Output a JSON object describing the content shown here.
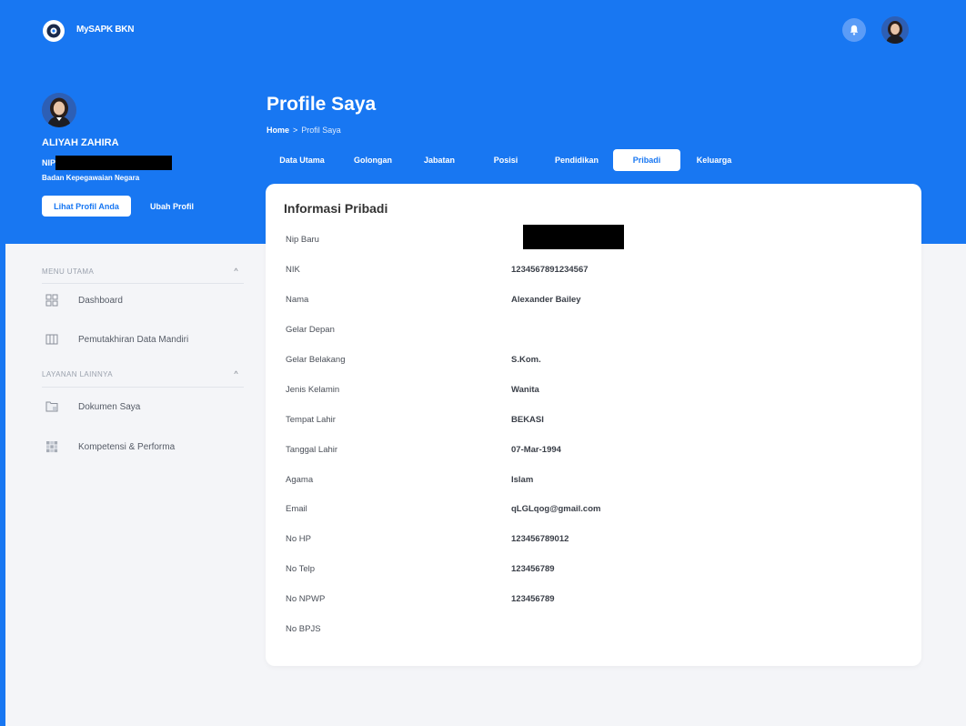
{
  "app": {
    "title": "MySAPK BKN"
  },
  "header": {
    "icons": [
      "bell-icon",
      "user-avatar"
    ]
  },
  "profile": {
    "name": "ALIYAH ZAHIRA",
    "nip_label": "NIP",
    "organization": "Badan Kepegawaian Negara",
    "view_button": "Lihat Profil Anda",
    "edit_button": "Ubah Profil"
  },
  "page": {
    "title": "Profile Saya",
    "breadcrumb": {
      "home": "Home",
      "separator": ">",
      "current": "Profil Saya"
    }
  },
  "tabs": [
    {
      "label": "Data Utama",
      "active": false
    },
    {
      "label": "Golongan",
      "active": false
    },
    {
      "label": "Jabatan",
      "active": false
    },
    {
      "label": "Posisi",
      "active": false
    },
    {
      "label": "Pendidikan",
      "active": false
    },
    {
      "label": "Pribadi",
      "active": true
    },
    {
      "label": "Keluarga",
      "active": false
    }
  ],
  "sidebar": {
    "sections": [
      {
        "title": "MENU UTAMA",
        "items": [
          {
            "label": "Dashboard",
            "icon": "dashboard-icon"
          },
          {
            "label": "Pemutakhiran Data Mandiri",
            "icon": "data-update-icon"
          }
        ]
      },
      {
        "title": "LAYANAN LAINNYA",
        "items": [
          {
            "label": "Dokumen Saya",
            "icon": "document-icon"
          },
          {
            "label": "Kompetensi & Performa",
            "icon": "grid-icon"
          }
        ]
      }
    ]
  },
  "card": {
    "title": "Informasi Pribadi",
    "fields": [
      {
        "label": "Nip Baru",
        "value": "",
        "redacted": true
      },
      {
        "label": "NIK",
        "value": "1234567891234567"
      },
      {
        "label": "Nama",
        "value": "Alexander Bailey"
      },
      {
        "label": "Gelar Depan",
        "value": ""
      },
      {
        "label": "Gelar Belakang",
        "value": "S.Kom."
      },
      {
        "label": "Jenis Kelamin",
        "value": "Wanita"
      },
      {
        "label": "Tempat Lahir",
        "value": "BEKASI"
      },
      {
        "label": "Tanggal Lahir",
        "value": "07-Mar-1994"
      },
      {
        "label": "Agama",
        "value": "Islam"
      },
      {
        "label": "Email",
        "value": "qLGLqog@gmail.com"
      },
      {
        "label": "No HP",
        "value": "123456789012"
      },
      {
        "label": "No Telp",
        "value": "123456789"
      },
      {
        "label": "No NPWP",
        "value": "123456789"
      },
      {
        "label": "No BPJS",
        "value": ""
      }
    ]
  },
  "colors": {
    "primary": "#1877f2",
    "background": "#f4f5f8",
    "card": "#ffffff"
  }
}
